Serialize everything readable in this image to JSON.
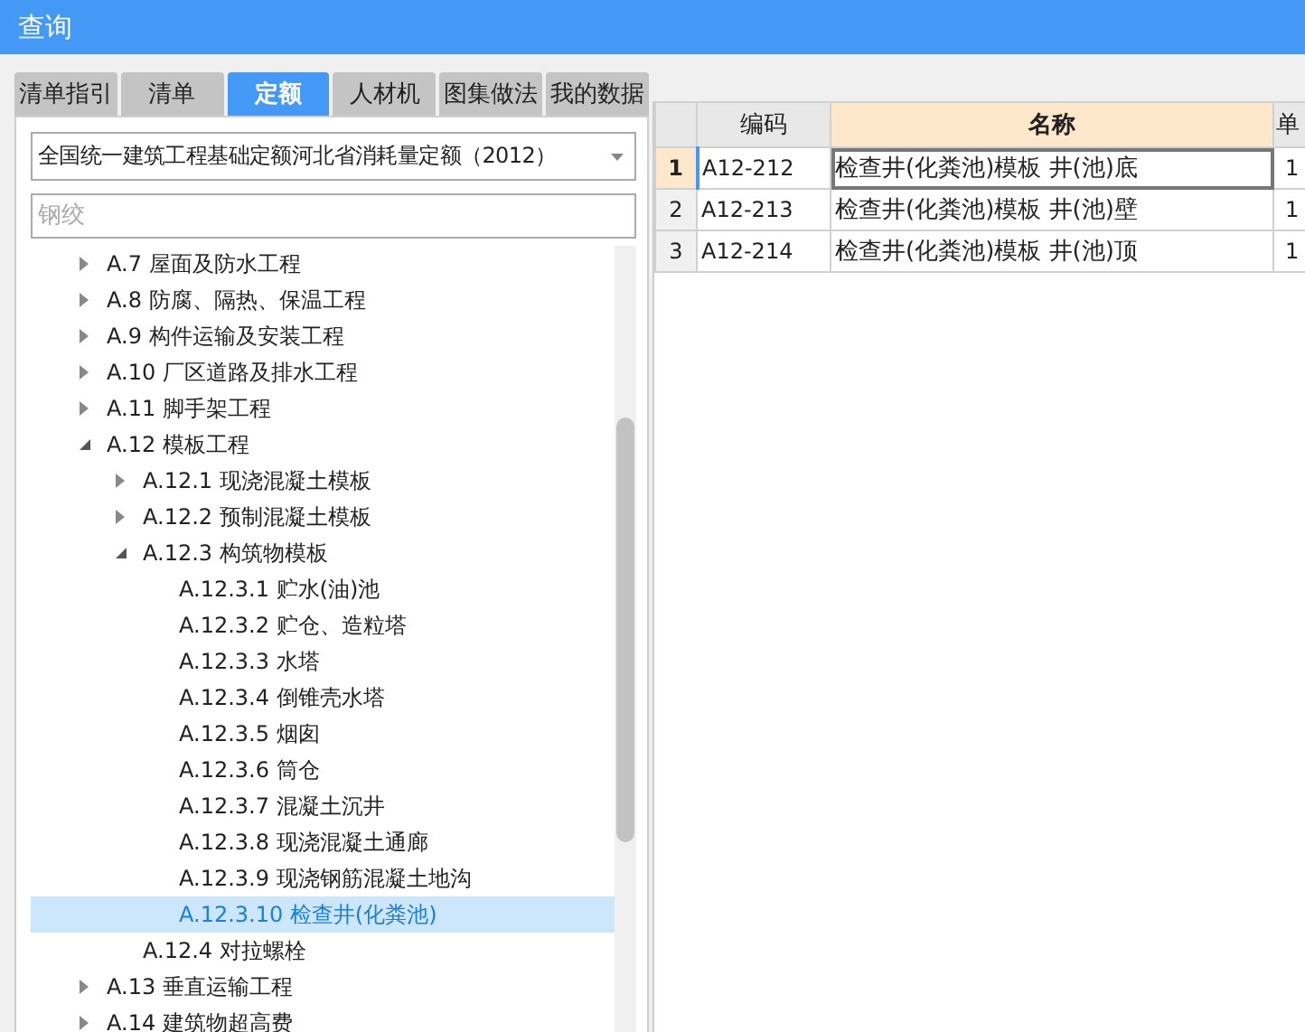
{
  "window": {
    "title": "查询"
  },
  "tabs": [
    {
      "label": "清单指引",
      "selected": false
    },
    {
      "label": "清单",
      "selected": false
    },
    {
      "label": "定额",
      "selected": true
    },
    {
      "label": "人材机",
      "selected": false
    },
    {
      "label": "图集做法",
      "selected": false
    },
    {
      "label": "我的数据",
      "selected": false
    }
  ],
  "library_dropdown": {
    "value": "全国统一建筑工程基础定额河北省消耗量定额（2012）"
  },
  "search": {
    "placeholder": "钢绞"
  },
  "tree": [
    {
      "label": "A.7 屋面及防水工程",
      "expanded": false,
      "selected": false
    },
    {
      "label": "A.8 防腐、隔热、保温工程",
      "expanded": false,
      "selected": false
    },
    {
      "label": "A.9 构件运输及安装工程",
      "expanded": false,
      "selected": false
    },
    {
      "label": "A.10 厂区道路及排水工程",
      "expanded": false,
      "selected": false
    },
    {
      "label": "A.11 脚手架工程",
      "expanded": false,
      "selected": false
    },
    {
      "label": "A.12 模板工程",
      "expanded": true,
      "selected": false,
      "children": [
        {
          "label": "A.12.1 现浇混凝土模板",
          "expanded": false,
          "selected": false
        },
        {
          "label": "A.12.2 预制混凝土模板",
          "expanded": false,
          "selected": false
        },
        {
          "label": "A.12.3 构筑物模板",
          "expanded": true,
          "selected": false,
          "children": [
            {
              "label": "A.12.3.1 贮水(油)池",
              "selected": false
            },
            {
              "label": "A.12.3.2 贮仓、造粒塔",
              "selected": false
            },
            {
              "label": "A.12.3.3 水塔",
              "selected": false
            },
            {
              "label": "A.12.3.4 倒锥壳水塔",
              "selected": false
            },
            {
              "label": "A.12.3.5 烟囱",
              "selected": false
            },
            {
              "label": "A.12.3.6 筒仓",
              "selected": false
            },
            {
              "label": "A.12.3.7 混凝土沉井",
              "selected": false
            },
            {
              "label": "A.12.3.8 现浇混凝土通廊",
              "selected": false
            },
            {
              "label": "A.12.3.9 现浇钢筋混凝土地沟",
              "selected": false
            },
            {
              "label": "A.12.3.10 检查井(化粪池)",
              "selected": true
            }
          ]
        },
        {
          "label": "A.12.4 对拉螺栓",
          "selected": false
        }
      ]
    },
    {
      "label": "A.13 垂直运输工程",
      "expanded": false,
      "selected": false
    },
    {
      "label": "A.14 建筑物超高费",
      "expanded": false,
      "selected": false
    }
  ],
  "table": {
    "columns": [
      "编码",
      "名称",
      "单"
    ],
    "rows": [
      {
        "number": "1",
        "selected": true,
        "cells": [
          "A12-212",
          "检查井(化粪池)模板 井(池)底",
          "1"
        ]
      },
      {
        "number": "2",
        "selected": false,
        "cells": [
          "A12-213",
          "检查井(化粪池)模板 井(池)壁",
          "1"
        ]
      },
      {
        "number": "3",
        "selected": false,
        "cells": [
          "A12-214",
          "检查井(化粪池)模板 井(池)顶",
          "1"
        ]
      }
    ]
  }
}
